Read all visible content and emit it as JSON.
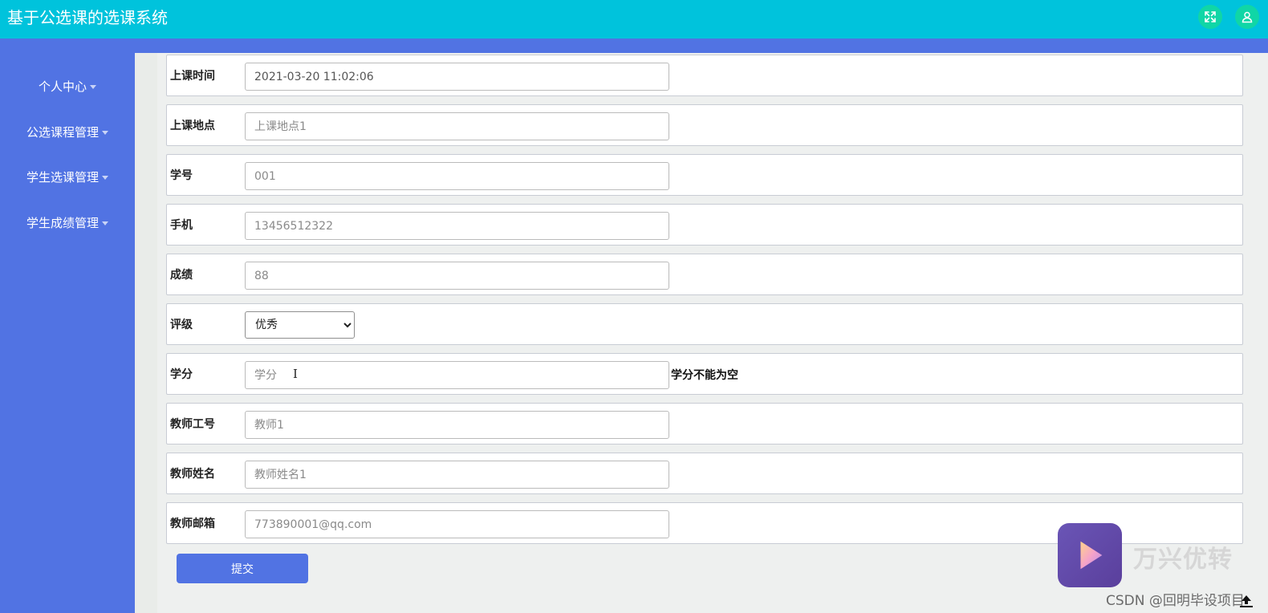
{
  "header": {
    "title": "基于公选课的选课系统"
  },
  "sidebar": {
    "items": [
      {
        "label": "个人中心"
      },
      {
        "label": "公选课程管理"
      },
      {
        "label": "学生选课管理"
      },
      {
        "label": "学生成绩管理"
      }
    ]
  },
  "form": {
    "rows": [
      {
        "label": "上课时间",
        "value": "2021-03-20 11:02:06"
      },
      {
        "label": "上课地点",
        "placeholder": "上课地点1"
      },
      {
        "label": "学号",
        "placeholder": "001"
      },
      {
        "label": "手机",
        "placeholder": "13456512322"
      },
      {
        "label": "成绩",
        "placeholder": "88"
      },
      {
        "label": "评级",
        "selected": "优秀"
      },
      {
        "label": "学分",
        "placeholder": "学分",
        "error": "学分不能为空"
      },
      {
        "label": "教师工号",
        "placeholder": "教师1"
      },
      {
        "label": "教师姓名",
        "placeholder": "教师姓名1"
      },
      {
        "label": "教师邮箱",
        "placeholder": "773890001@qq.com"
      }
    ],
    "submit_label": "提交"
  },
  "watermark": {
    "brand": "万兴优转",
    "credit": "CSDN @回明毕设项目"
  },
  "colors": {
    "topbar": "#00c3dc",
    "sidebar": "#5173e3",
    "icon_button": "#10d6a6",
    "submit": "#5173e3"
  },
  "icons": {
    "expand": "expand-icon",
    "user": "user-icon",
    "scroll_top": "scroll-top-icon"
  }
}
